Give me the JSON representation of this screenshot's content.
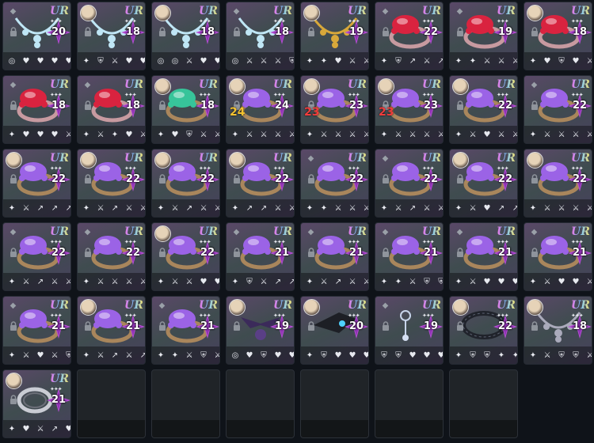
{
  "inventory": {
    "rarity_text": "UR",
    "star_glyph": "✦✦✦",
    "items": [
      {
        "type": "necklace-ice",
        "portrait": false,
        "level": "20",
        "slots": [
          "target",
          "heart",
          "heart",
          "heart",
          "heart"
        ]
      },
      {
        "type": "necklace-ice",
        "portrait": true,
        "level": "18",
        "slots": [
          "shuriken",
          "shield",
          "sword",
          "heart",
          "heart"
        ]
      },
      {
        "type": "necklace-ice",
        "portrait": true,
        "level": "18",
        "slots": [
          "target",
          "target",
          "sword",
          "heart",
          "heart"
        ]
      },
      {
        "type": "necklace-ice",
        "portrait": false,
        "level": "18",
        "slots": [
          "target",
          "sword",
          "sword",
          "sword",
          "shield"
        ]
      },
      {
        "type": "necklace-gold",
        "portrait": true,
        "level": "19",
        "slots": [
          "shuriken",
          "shuriken",
          "heart",
          "sword",
          "sword"
        ]
      },
      {
        "type": "ring-ruby",
        "portrait": false,
        "level": "22",
        "slots": [
          "shuriken",
          "shield",
          "arrow",
          "sword",
          "arrow"
        ]
      },
      {
        "type": "ring-ruby",
        "portrait": false,
        "level": "19",
        "slots": [
          "shuriken",
          "shuriken",
          "sword",
          "sword",
          "sword"
        ]
      },
      {
        "type": "ring-ruby",
        "portrait": true,
        "level": "18",
        "slots": [
          "shuriken",
          "heart",
          "shield",
          "heart",
          "sword"
        ]
      },
      {
        "type": "ring-ruby",
        "portrait": false,
        "level": "18",
        "slots": [
          "shuriken",
          "heart",
          "heart",
          "heart",
          "sword"
        ]
      },
      {
        "type": "ring-ruby",
        "portrait": false,
        "level": "18",
        "slots": [
          "shuriken",
          "sword",
          "shuriken",
          "heart",
          "sword"
        ]
      },
      {
        "type": "ring-emerald",
        "portrait": true,
        "level": "18",
        "slots": [
          "shuriken",
          "heart",
          "shield",
          "sword",
          "sword"
        ]
      },
      {
        "type": "ring-amethyst",
        "portrait": true,
        "level": "24",
        "option": "24",
        "option_color": "gold",
        "slots": [
          "shuriken",
          "sword",
          "sword",
          "sword",
          "sword"
        ]
      },
      {
        "type": "ring-amethyst",
        "portrait": true,
        "level": "23",
        "option": "23",
        "option_color": "red",
        "slots": [
          "shuriken",
          "sword",
          "sword",
          "sword",
          "sword"
        ]
      },
      {
        "type": "ring-amethyst",
        "portrait": true,
        "level": "23",
        "option": "23",
        "option_color": "red",
        "slots": [
          "shuriken",
          "sword",
          "sword",
          "sword",
          "sword"
        ]
      },
      {
        "type": "ring-amethyst",
        "portrait": true,
        "level": "22",
        "slots": [
          "shuriken",
          "sword",
          "heart",
          "sword",
          "sword"
        ]
      },
      {
        "type": "ring-amethyst",
        "portrait": false,
        "level": "22",
        "slots": [
          "shuriken",
          "sword",
          "sword",
          "sword",
          "sword"
        ]
      },
      {
        "type": "ring-amethyst",
        "portrait": true,
        "level": "22",
        "slots": [
          "shuriken",
          "sword",
          "arrow",
          "arrow",
          "arrow"
        ]
      },
      {
        "type": "ring-amethyst",
        "portrait": true,
        "level": "22",
        "slots": [
          "shuriken",
          "sword",
          "arrow",
          "sword",
          "sword"
        ]
      },
      {
        "type": "ring-amethyst",
        "portrait": true,
        "level": "22",
        "slots": [
          "shuriken",
          "sword",
          "arrow",
          "sword",
          "sword"
        ]
      },
      {
        "type": "ring-amethyst",
        "portrait": true,
        "level": "22",
        "slots": [
          "shuriken",
          "arrow",
          "arrow",
          "sword",
          "sword"
        ]
      },
      {
        "type": "ring-amethyst",
        "portrait": false,
        "level": "22",
        "slots": [
          "shuriken",
          "shuriken",
          "sword",
          "sword",
          "sword"
        ]
      },
      {
        "type": "ring-amethyst",
        "portrait": false,
        "level": "22",
        "slots": [
          "shuriken",
          "sword",
          "arrow",
          "sword",
          "sword"
        ]
      },
      {
        "type": "ring-amethyst",
        "portrait": true,
        "level": "22",
        "slots": [
          "shuriken",
          "sword",
          "heart",
          "arrow",
          "arrow"
        ]
      },
      {
        "type": "ring-amethyst",
        "portrait": true,
        "level": "22",
        "slots": [
          "shuriken",
          "sword",
          "sword",
          "sword",
          "sword"
        ]
      },
      {
        "type": "ring-amethyst",
        "portrait": false,
        "level": "22",
        "slots": [
          "shuriken",
          "sword",
          "arrow",
          "sword",
          "sword"
        ]
      },
      {
        "type": "ring-amethyst",
        "portrait": false,
        "level": "22",
        "slots": [
          "shuriken",
          "sword",
          "sword",
          "sword",
          "sword"
        ]
      },
      {
        "type": "ring-amethyst",
        "portrait": true,
        "level": "22",
        "slots": [
          "shuriken",
          "sword",
          "sword",
          "heart",
          "heart"
        ]
      },
      {
        "type": "ring-amethyst",
        "portrait": false,
        "level": "21",
        "slots": [
          "shuriken",
          "shield",
          "sword",
          "arrow",
          "arrow"
        ]
      },
      {
        "type": "ring-amethyst",
        "portrait": false,
        "level": "21",
        "slots": [
          "shuriken",
          "sword",
          "arrow",
          "sword",
          "sword"
        ]
      },
      {
        "type": "ring-amethyst",
        "portrait": false,
        "level": "21",
        "slots": [
          "shuriken",
          "shuriken",
          "sword",
          "shield",
          "shield"
        ]
      },
      {
        "type": "ring-amethyst",
        "portrait": false,
        "level": "21",
        "slots": [
          "shuriken",
          "sword",
          "heart",
          "heart",
          "heart"
        ]
      },
      {
        "type": "ring-amethyst",
        "portrait": false,
        "level": "21",
        "slots": [
          "shuriken",
          "sword",
          "heart",
          "heart",
          "sword"
        ]
      },
      {
        "type": "ring-amethyst",
        "portrait": false,
        "level": "21",
        "slots": [
          "shuriken",
          "sword",
          "heart",
          "sword",
          "shield"
        ]
      },
      {
        "type": "ring-amethyst",
        "portrait": true,
        "level": "21",
        "slots": [
          "shuriken",
          "sword",
          "arrow",
          "sword",
          "arrow"
        ]
      },
      {
        "type": "ring-amethyst",
        "portrait": false,
        "level": "21",
        "slots": [
          "shuriken",
          "shuriken",
          "sword",
          "shield",
          "sword"
        ]
      },
      {
        "type": "earring-dark",
        "portrait": true,
        "level": "19",
        "slots": [
          "target",
          "heart",
          "shield",
          "heart",
          "heart"
        ]
      },
      {
        "type": "earring-blade",
        "portrait": true,
        "level": "20",
        "slots": [
          "shuriken",
          "shield",
          "heart",
          "heart",
          "heart"
        ]
      },
      {
        "type": "earring-silver",
        "portrait": false,
        "level": "19",
        "slots": [
          "shield",
          "shield",
          "heart",
          "heart",
          "heart"
        ]
      },
      {
        "type": "bracelet-chain",
        "portrait": true,
        "level": "22",
        "slots": [
          "shuriken",
          "shield",
          "shield",
          "shuriken",
          "shuriken"
        ]
      },
      {
        "type": "necklace-chain",
        "portrait": true,
        "level": "18",
        "slots": [
          "shuriken",
          "sword",
          "shield",
          "shield",
          "sword"
        ]
      },
      {
        "type": "ring-silver",
        "portrait": true,
        "level": "21",
        "slots": [
          "shuriken",
          "heart",
          "sword",
          "arrow",
          "heart"
        ]
      },
      {
        "type": "empty"
      },
      {
        "type": "empty"
      },
      {
        "type": "empty"
      },
      {
        "type": "empty"
      },
      {
        "type": "empty"
      },
      {
        "type": "empty"
      }
    ]
  },
  "icon_glyphs": {
    "shuriken": "✦",
    "target": "◎",
    "heart": "♥",
    "sword": "⚔",
    "shield": "⛨",
    "arrow": "↗"
  },
  "colors": {
    "ring-ruby": "#d9233f",
    "ring-amethyst": "#9b63e6",
    "ring-emerald": "#37c49a",
    "necklace-ice": "#bfe6f5",
    "necklace-gold": "#d8a83a",
    "gold": "#f2c230",
    "red": "#f03c3c"
  }
}
